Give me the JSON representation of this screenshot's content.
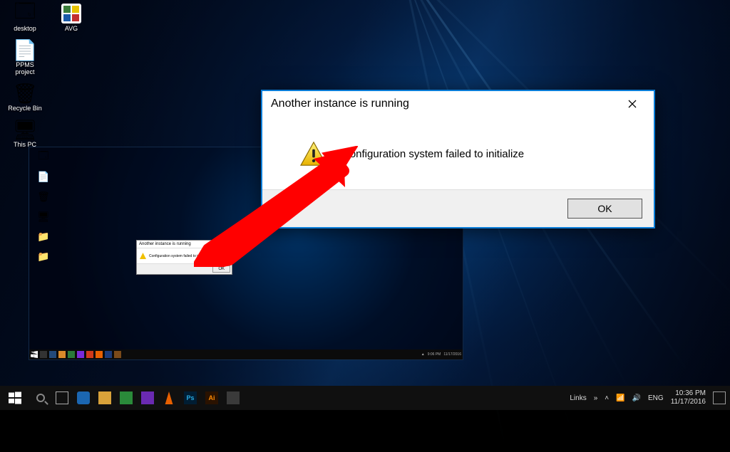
{
  "desktop_icons": [
    {
      "name": "desktop-icon-desktop",
      "label": "desktop",
      "glyph": "🗔",
      "color": "#4aa8e0"
    },
    {
      "name": "desktop-icon-ppms",
      "label": "PPMS project",
      "glyph": "📄",
      "color": "#e8e8e8"
    },
    {
      "name": "desktop-icon-recycle",
      "label": "Recycle Bin",
      "glyph": "🗑",
      "color": "#5fb0dd"
    },
    {
      "name": "desktop-icon-thispc",
      "label": "This PC",
      "glyph": "🖥",
      "color": "#5fb0dd"
    }
  ],
  "avg_icon": {
    "name": "desktop-icon-avg",
    "label": "AVG"
  },
  "nested_taskbar_time": "9:06 PM",
  "nested_taskbar_date": "11/17/2016",
  "nested_taskbar_apps": [
    "win",
    "search",
    "task",
    "edge",
    "folder",
    "store",
    "mail",
    "cam",
    "ppt",
    "vlc",
    "ps",
    "ai",
    "word",
    "chrome"
  ],
  "nested_dialog": {
    "title": "Another instance is running",
    "message": "Configuration system failed to initialize",
    "ok": "OK",
    "close": "×"
  },
  "main_dialog": {
    "title": "Another instance is running",
    "message": "Configuration system failed to initialize",
    "ok": "OK"
  },
  "outer_taskbar": {
    "links_label": "Links",
    "lang": "ENG",
    "time": "10:36 PM",
    "date": "11/17/2016",
    "apps": [
      "win",
      "search",
      "task",
      "edge",
      "folder",
      "store",
      "vlc",
      "ps",
      "ai",
      "chrome"
    ]
  },
  "colors": {
    "dialog_border": "#0a7dd8",
    "arrow": "#ff0000"
  }
}
